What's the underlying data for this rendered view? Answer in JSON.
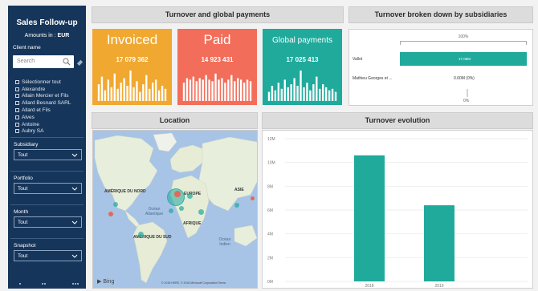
{
  "sidebar": {
    "title": "Sales Follow-up",
    "amount_label": "Amounts in :",
    "amount_currency": "EUR",
    "client_label": "Client name",
    "search_placeholder": "Search",
    "clients": [
      "Sélectionner tout",
      "Alexandre",
      "Allain Mercier et Fils",
      "Allard Besnard SARL",
      "Allard et Fils",
      "Alves",
      "Antoine",
      "Aubry SA"
    ],
    "slicers": [
      {
        "label": "Subsidiary",
        "value": "Tout"
      },
      {
        "label": "Portfolio",
        "value": "Tout"
      },
      {
        "label": "Month",
        "value": "Tout"
      },
      {
        "label": "Snapshot",
        "value": "Tout"
      }
    ]
  },
  "headers": {
    "turnover_payments": "Turnover and global payments",
    "subsidiaries": "Turnover broken down by subsidiaries",
    "location": "Location",
    "evolution": "Turnover evolution"
  },
  "kpis": [
    {
      "title": "Invoiced",
      "value": "17 079 362",
      "color": "#f0a830",
      "bars": [
        0.55,
        0.8,
        0.35,
        0.7,
        0.45,
        0.9,
        0.4,
        0.6,
        0.75,
        0.5,
        1.0,
        0.45,
        0.65,
        0.3,
        0.55,
        0.85,
        0.4,
        0.6,
        0.7,
        0.35,
        0.5,
        0.4
      ]
    },
    {
      "title": "Paid",
      "value": "14 923 431",
      "color": "#f26e5a",
      "bars": [
        0.6,
        0.75,
        0.7,
        0.8,
        0.65,
        0.75,
        0.7,
        0.85,
        0.7,
        0.65,
        0.9,
        0.7,
        0.75,
        0.6,
        0.7,
        0.85,
        0.65,
        0.75,
        0.7,
        0.6,
        0.7,
        0.65
      ]
    },
    {
      "title": "Global payments",
      "value": "17 025 413",
      "color": "#1faa9c",
      "bars": [
        0.3,
        0.5,
        0.35,
        0.6,
        0.4,
        0.7,
        0.45,
        0.55,
        0.75,
        0.5,
        1.0,
        0.45,
        0.6,
        0.35,
        0.55,
        0.8,
        0.4,
        0.55,
        0.45,
        0.35,
        0.4,
        0.3
      ]
    }
  ],
  "subsidiaries": {
    "axis_top": "100%",
    "axis_bottom": "0%",
    "rows": [
      {
        "name": "Vallot",
        "value": 17.08,
        "label": "17.08M"
      },
      {
        "name": "Mathieu Georges et ...",
        "value": 0.0,
        "label": "0.00M (0%)"
      }
    ]
  },
  "map": {
    "continents": [
      "AMÉRIQUE DU NORD",
      "EUROPE",
      "ASIE",
      "AFRIQUE",
      "AMÉRIQUE DU SUD"
    ],
    "oceans": [
      "Océan Atlantique",
      "Océan Indien"
    ],
    "provider": "Bing",
    "copyright": "© 2018 HERE, © 2018 Microsoft Corporation Terms"
  },
  "chart_data": {
    "type": "bar",
    "categories": [
      "2018",
      "2019"
    ],
    "values": [
      10.6,
      6.4
    ],
    "ylim": [
      0,
      12
    ],
    "yticks": [
      "0M",
      "2M",
      "4M",
      "6M",
      "8M",
      "10M",
      "12M"
    ],
    "title": "Turnover evolution",
    "xlabel": "",
    "ylabel": "",
    "grid": true,
    "color": "#1faa9c"
  }
}
